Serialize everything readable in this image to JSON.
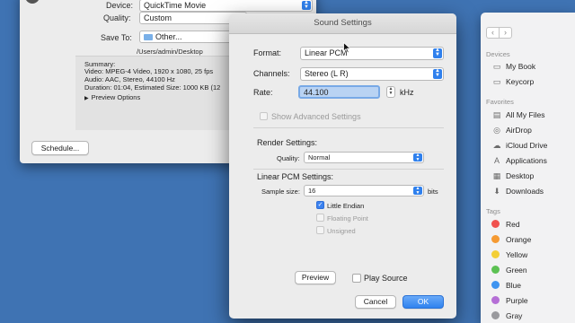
{
  "export_window": {
    "device_label": "Device:",
    "device_value": "QuickTime Movie",
    "quality_label": "Quality:",
    "quality_value": "Custom",
    "save_to_label": "Save To:",
    "save_to_value": "Other...",
    "path": "/Users/admin/Desktop",
    "summary_title": "Summary:",
    "summary_lines": [
      "Video: MPEG-4 Video, 1920 x 1080, 25 fps",
      "Audio: AAC, Stereo, 44100 Hz",
      "Duration: 01:04, Estimated Size: 1000 KB (12"
    ],
    "preview_options": "Preview Options",
    "schedule_button": "Schedule..."
  },
  "sound_settings": {
    "title": "Sound Settings",
    "format_label": "Format:",
    "format_value": "Linear PCM",
    "channels_label": "Channels:",
    "channels_value": "Stereo (L R)",
    "rate_label": "Rate:",
    "rate_value": "44.100",
    "rate_unit": "kHz",
    "show_advanced": "Show Advanced Settings",
    "render_heading": "Render Settings:",
    "quality_label": "Quality:",
    "quality_value": "Normal",
    "pcm_heading": "Linear PCM Settings:",
    "sample_size_label": "Sample size:",
    "sample_size_value": "16",
    "sample_size_unit": "bits",
    "little_endian": "Little Endian",
    "floating_point": "Floating Point",
    "unsigned": "Unsigned",
    "preview_button": "Preview",
    "play_source": "Play Source",
    "cancel_button": "Cancel",
    "ok_button": "OK"
  },
  "finder": {
    "devices_heading": "Devices",
    "devices": [
      "My Book",
      "Keycorp"
    ],
    "favorites_heading": "Favorites",
    "favorites": [
      "All My Files",
      "AirDrop",
      "iCloud Drive",
      "Applications",
      "Desktop",
      "Downloads"
    ],
    "tags_heading": "Tags",
    "tags": [
      {
        "name": "Red",
        "color": "#f0524f"
      },
      {
        "name": "Orange",
        "color": "#f59a33"
      },
      {
        "name": "Yellow",
        "color": "#f3cf37"
      },
      {
        "name": "Green",
        "color": "#5cc153"
      },
      {
        "name": "Blue",
        "color": "#3e94f0"
      },
      {
        "name": "Purple",
        "color": "#b56fd6"
      },
      {
        "name": "Gray",
        "color": "#9a9a9e"
      }
    ]
  }
}
